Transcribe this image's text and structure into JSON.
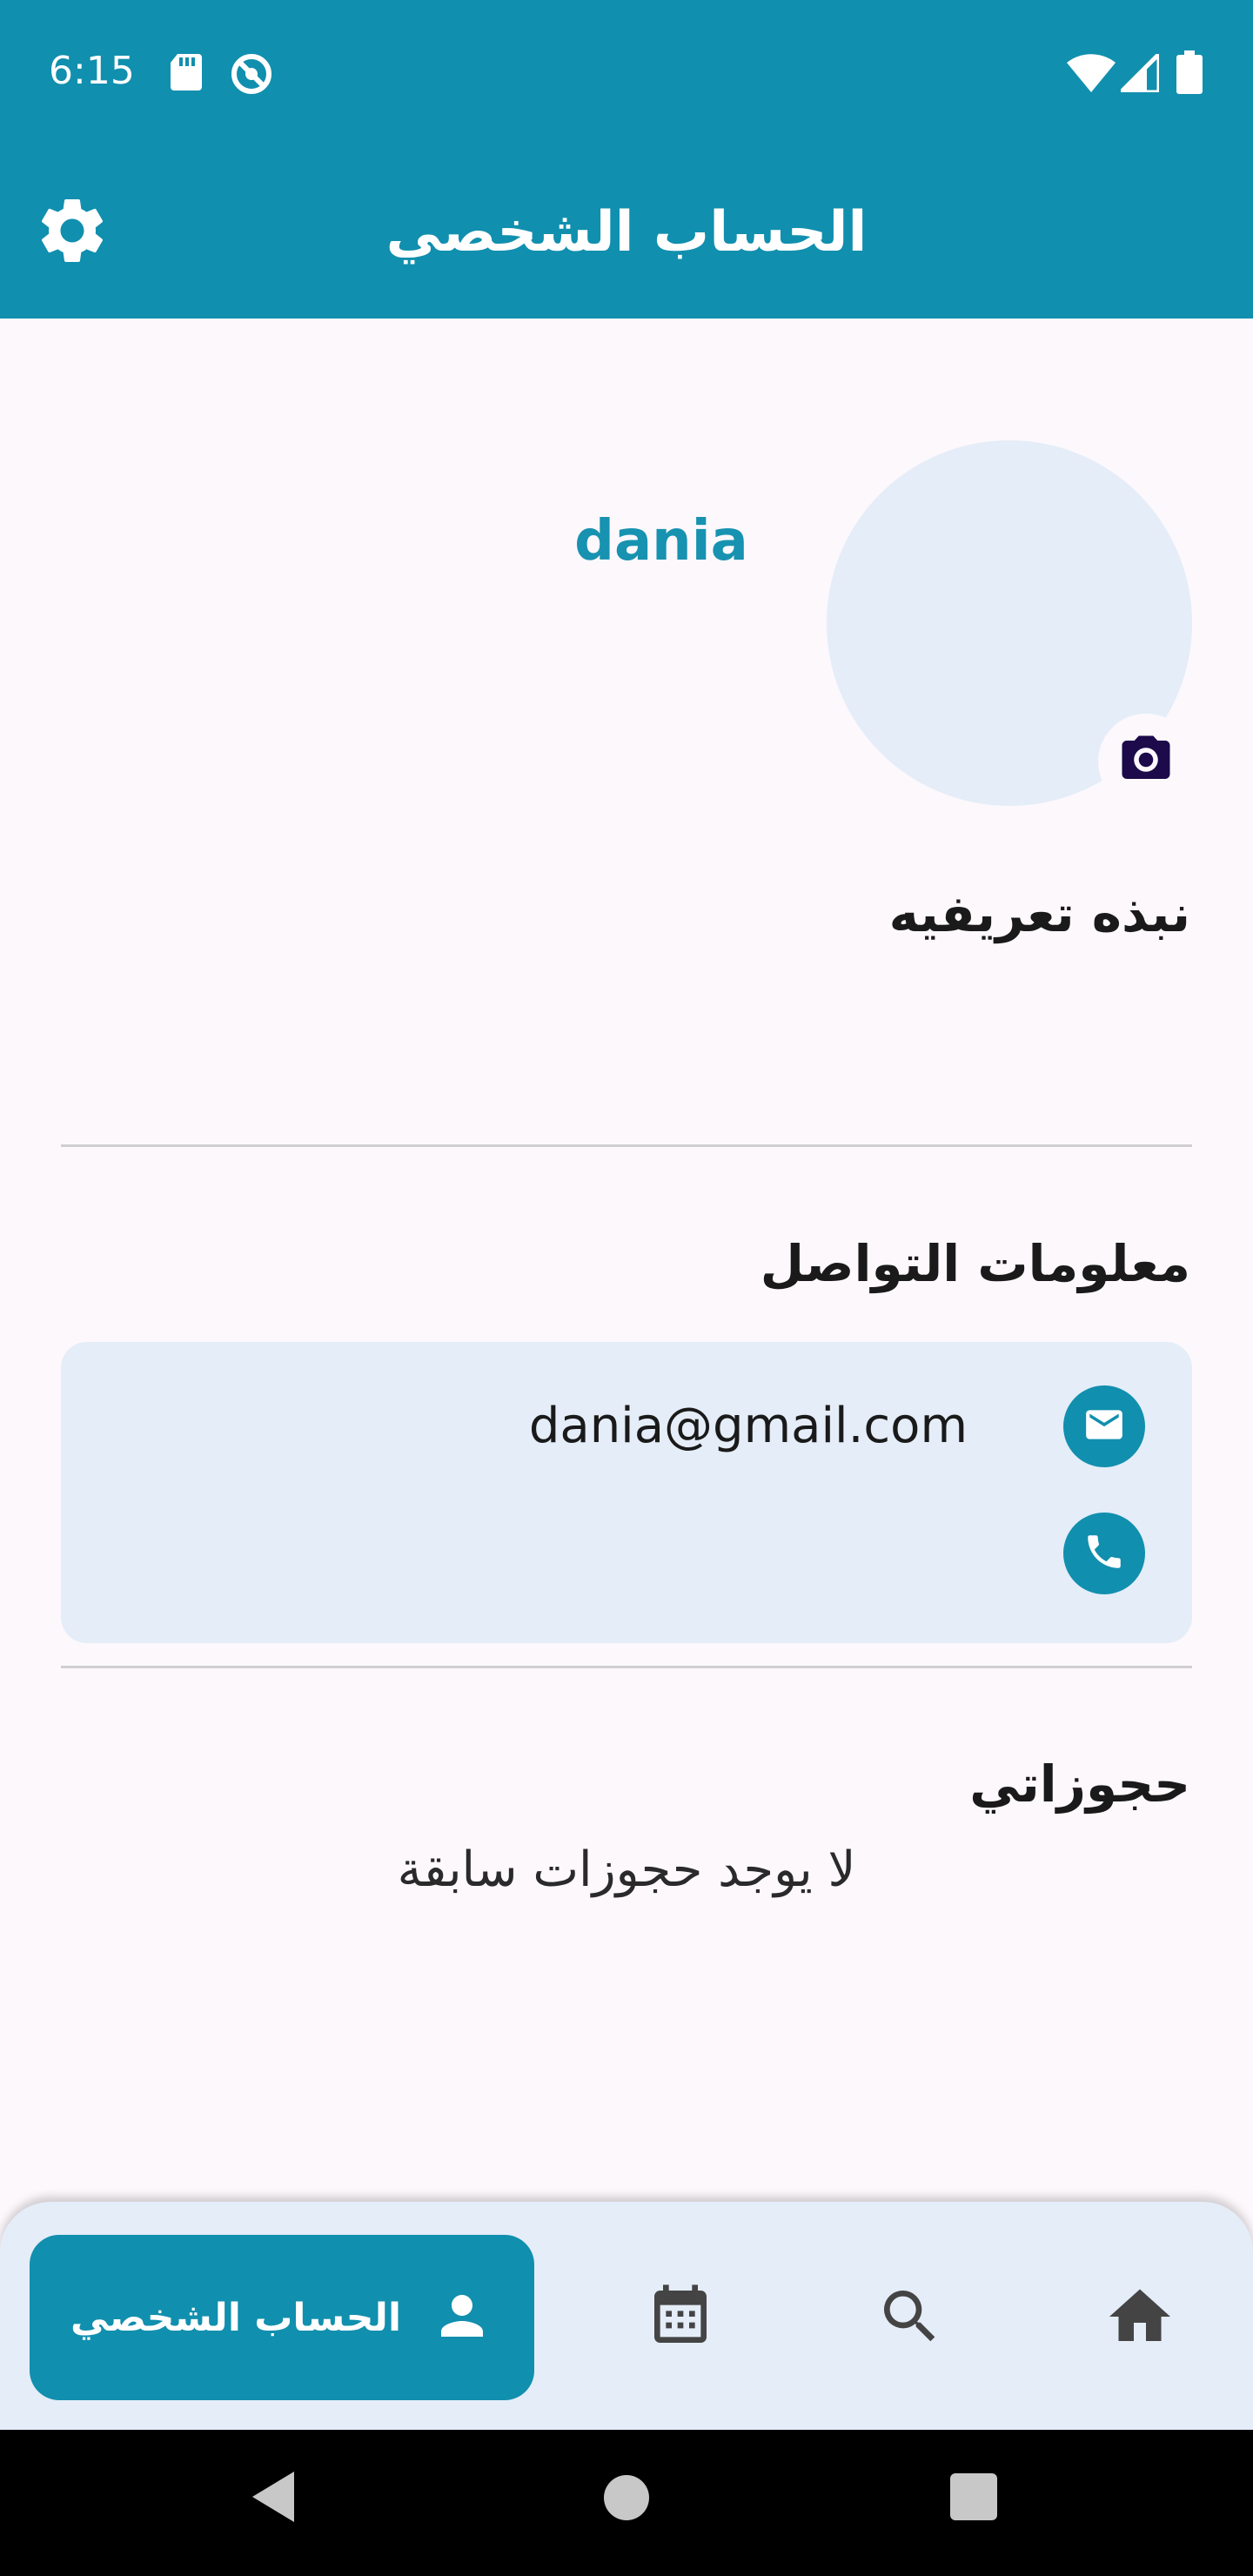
{
  "status_bar": {
    "time": "6:15",
    "left_icons": [
      "sd-card-icon",
      "sync-disabled-icon"
    ],
    "right_icons": [
      "wifi-icon",
      "signal-icon",
      "battery-icon"
    ]
  },
  "app_bar": {
    "title": "الحساب الشخصي",
    "settings_icon": "gear-icon"
  },
  "profile": {
    "username": "dania",
    "avatar_icon": "camera-icon"
  },
  "bio": {
    "title": "نبذه تعريفيه"
  },
  "contact": {
    "title": "معلومات التواصل",
    "email": "dania@gmail.com",
    "phone": ""
  },
  "bookings": {
    "title": "حجوزاتي",
    "empty_message": "لا يوجد حجوزات سابقة"
  },
  "bottom_nav": {
    "items": [
      {
        "label": "الحساب الشخصي",
        "icon": "person-icon",
        "active": true
      },
      {
        "label": "",
        "icon": "calendar-icon",
        "active": false
      },
      {
        "label": "",
        "icon": "search-icon",
        "active": false
      },
      {
        "label": "",
        "icon": "home-icon",
        "active": false
      }
    ]
  },
  "colors": {
    "primary": "#118fae",
    "card_bg": "#e4edf8",
    "page_bg": "#fdf8fc"
  }
}
